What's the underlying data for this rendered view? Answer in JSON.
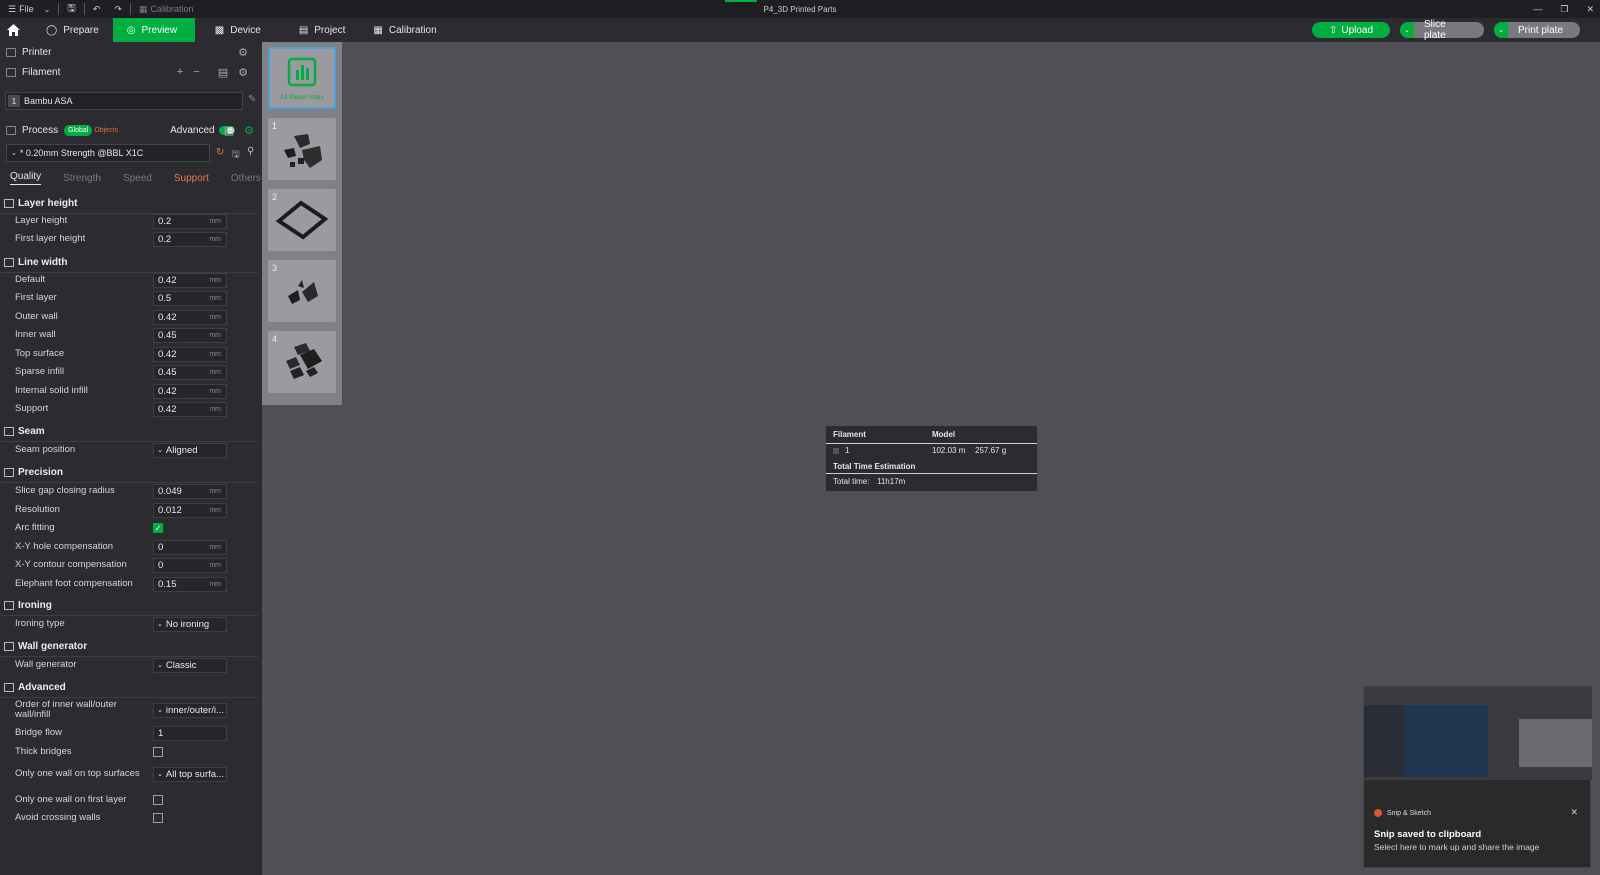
{
  "titlebar": {
    "file_label": "File",
    "calibration_label": "Calibration",
    "title": "P4_3D Printed Parts"
  },
  "toolbar": {
    "tabs": [
      {
        "label": "Prepare"
      },
      {
        "label": "Preview"
      },
      {
        "label": "Device"
      },
      {
        "label": "Project"
      },
      {
        "label": "Calibration"
      }
    ],
    "upload_label": "Upload",
    "slice_label": "Slice plate",
    "print_label": "Print plate",
    "accent": "#00ae42"
  },
  "sidebar": {
    "printer_label": "Printer",
    "filament_label": "Filament",
    "filament": {
      "index": "1",
      "name": "Bambu ASA"
    },
    "process_label": "Process",
    "global_badge": "Global",
    "objects_badge": "Objects",
    "advanced_label": "Advanced",
    "preset": "* 0.20mm Strength @BBL X1C",
    "tabs": [
      "Quality",
      "Strength",
      "Speed",
      "Support",
      "Others"
    ],
    "groups": {
      "layer_height": "Layer height",
      "line_width": "Line width",
      "seam": "Seam",
      "precision": "Precision",
      "ironing": "Ironing",
      "wall_generator": "Wall generator",
      "advanced": "Advanced"
    },
    "unit": "mm",
    "options": {
      "layer_height": {
        "label": "Layer height",
        "value": "0.2"
      },
      "first_layer_height": {
        "label": "First layer height",
        "value": "0.2"
      },
      "lw_default": {
        "label": "Default",
        "value": "0.42"
      },
      "lw_first_layer": {
        "label": "First layer",
        "value": "0.5"
      },
      "lw_outer_wall": {
        "label": "Outer wall",
        "value": "0.42"
      },
      "lw_inner_wall": {
        "label": "Inner wall",
        "value": "0.45"
      },
      "lw_top_surface": {
        "label": "Top surface",
        "value": "0.42"
      },
      "lw_sparse_infill": {
        "label": "Sparse infill",
        "value": "0.45"
      },
      "lw_internal_solid": {
        "label": "Internal solid infill",
        "value": "0.42"
      },
      "lw_support": {
        "label": "Support",
        "value": "0.42"
      },
      "seam_position": {
        "label": "Seam position",
        "value": "Aligned"
      },
      "slice_gap": {
        "label": "Slice gap closing radius",
        "value": "0.049"
      },
      "resolution": {
        "label": "Resolution",
        "value": "0.012"
      },
      "arc_fitting": {
        "label": "Arc fitting",
        "checked": true
      },
      "xy_hole": {
        "label": "X-Y hole compensation",
        "value": "0"
      },
      "xy_contour": {
        "label": "X-Y contour compensation",
        "value": "0"
      },
      "elephant_foot": {
        "label": "Elephant foot compensation",
        "value": "0.15"
      },
      "ironing_type": {
        "label": "Ironing type",
        "value": "No ironing"
      },
      "wall_generator": {
        "label": "Wall generator",
        "value": "Classic"
      },
      "wall_order": {
        "label": "Order of inner wall/outer wall/infill",
        "value": "inner/outer/i..."
      },
      "bridge_flow": {
        "label": "Bridge flow",
        "value": "1"
      },
      "thick_bridges": {
        "label": "Thick bridges",
        "checked": false
      },
      "one_wall_top": {
        "label": "Only one wall on top surfaces",
        "value": "All top surfa..."
      },
      "one_wall_first": {
        "label": "Only one wall on first layer",
        "checked": false
      },
      "avoid_crossing": {
        "label": "Avoid crossing walls",
        "checked": false
      }
    }
  },
  "plates": {
    "all_label": "All Plates Stats",
    "items": [
      "1",
      "2",
      "3",
      "4"
    ]
  },
  "stats": {
    "filament_header": "Filament",
    "model_header": "Model",
    "row_index": "1",
    "length": "102.03 m",
    "weight": "257.67 g",
    "time_header": "Total Time Estimation",
    "time_label": "Total time:",
    "time_value": "11h17m"
  },
  "toast": {
    "app": "Snip & Sketch",
    "title": "Snip saved to clipboard",
    "body": "Select here to mark up and share the image"
  }
}
